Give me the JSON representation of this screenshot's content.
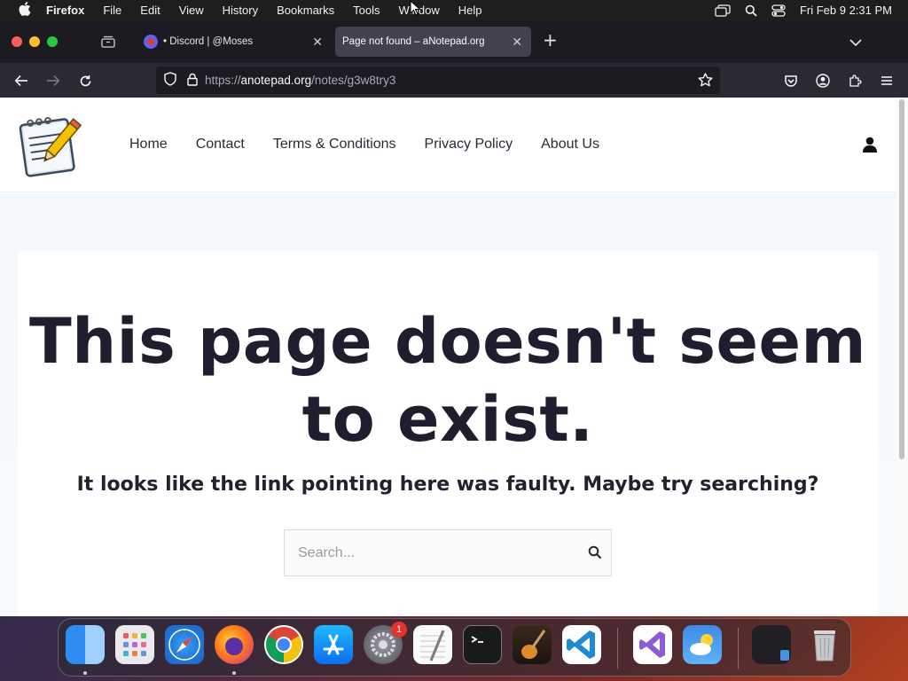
{
  "menubar": {
    "apple": "",
    "items": [
      "Firefox",
      "File",
      "Edit",
      "View",
      "History",
      "Bookmarks",
      "Tools",
      "Window",
      "Help"
    ],
    "datetime": "Fri Feb 9  2:31 PM"
  },
  "tabs": [
    {
      "title": "• Discord | @Moses",
      "close": "✕",
      "favicon": "discord-icon"
    },
    {
      "title": "Page not found – aNotepad.org",
      "close": "✕"
    }
  ],
  "newtab": "+",
  "url": {
    "prefix": "https://",
    "host": "anotepad.org",
    "path": "/notes/g3w8try3"
  },
  "site": {
    "nav": [
      "Home",
      "Contact",
      "Terms & Conditions",
      "Privacy Policy",
      "About Us"
    ],
    "headline_line1": "This page doesn't seem",
    "headline_line2": "to exist.",
    "subline": "It looks like the link pointing here was faulty. Maybe try searching?",
    "search_placeholder": "Search..."
  },
  "dock": {
    "apps": [
      "Finder",
      "Launchpad",
      "Safari",
      "Firefox",
      "Chrome",
      "App Store",
      "System Settings",
      "TextEdit",
      "Terminal",
      "GarageBand",
      "Visual Studio Code",
      "Visual Studio",
      "Weather",
      "Screen Preview",
      "Trash"
    ],
    "system_settings_badge": "1"
  },
  "colors": {
    "menubar_bg": "#1e1e1e",
    "tabbar_bg": "#1c1b22",
    "active_tab_bg": "#42414d",
    "headline": "#1f1d2e"
  }
}
